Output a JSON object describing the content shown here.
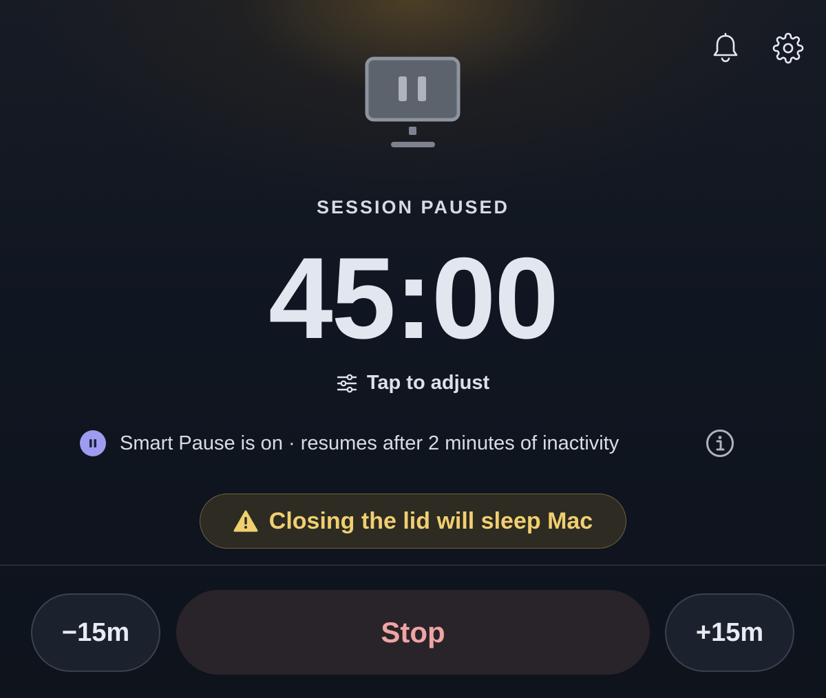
{
  "header": {
    "bell_icon": "bell-icon",
    "settings_icon": "gear-icon"
  },
  "hero": {
    "icon": "monitor-paused-icon"
  },
  "session": {
    "status": "SESSION PAUSED",
    "time": "45:00",
    "adjust_label": "Tap to adjust",
    "adjust_icon": "sliders-icon"
  },
  "smart_pause": {
    "text": "Smart Pause is on · resumes after 2 minutes of inactivity",
    "icon": "pause-circle-icon",
    "info_icon": "info-icon",
    "accent": "#9d9cf0"
  },
  "warning": {
    "text": "Closing the lid will sleep Mac",
    "icon": "warning-triangle-icon",
    "color": "#f0cf70"
  },
  "controls": {
    "minus_label": "−15m",
    "stop_label": "Stop",
    "plus_label": "+15m",
    "stop_color": "#f0a4a4"
  }
}
